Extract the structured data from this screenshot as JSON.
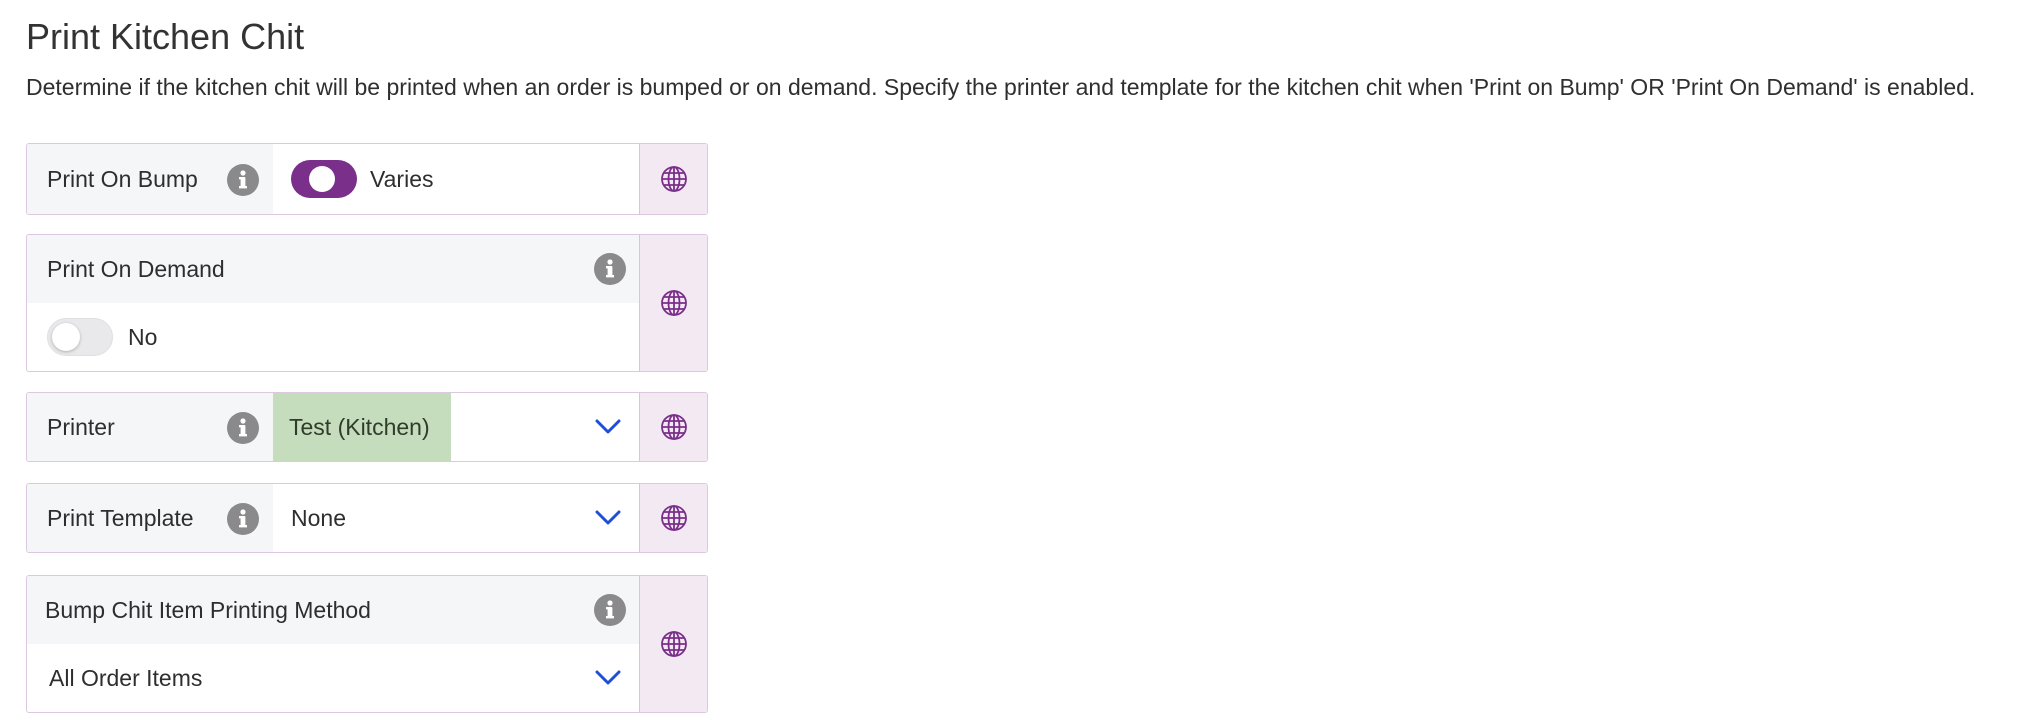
{
  "header": {
    "title": "Print Kitchen Chit",
    "description": "Determine if the kitchen chit will be printed when an order is bumped or on demand. Specify the printer and template for the kitchen chit when 'Print on Bump' OR 'Print On Demand' is enabled."
  },
  "settings": {
    "print_on_bump": {
      "label": "Print On Bump",
      "value": "Varies",
      "toggle_state": "on"
    },
    "print_on_demand": {
      "label": "Print On Demand",
      "value": "No",
      "toggle_state": "off"
    },
    "printer": {
      "label": "Printer",
      "selected": "Test (Kitchen)"
    },
    "print_template": {
      "label": "Print Template",
      "selected": "None"
    },
    "bump_chit_method": {
      "label": "Bump Chit Item Printing Method",
      "selected": "All Order Items"
    }
  },
  "icons": {
    "info": "info-icon",
    "globe": "globe-icon",
    "chevron": "chevron-down-icon"
  },
  "colors": {
    "toggle_on": "#7a2f8a",
    "globe_bg": "#f3e9f3",
    "chevron": "#1f4fd8",
    "selected_chip": "#c5dcbd",
    "label_bg": "#f5f6f8"
  }
}
